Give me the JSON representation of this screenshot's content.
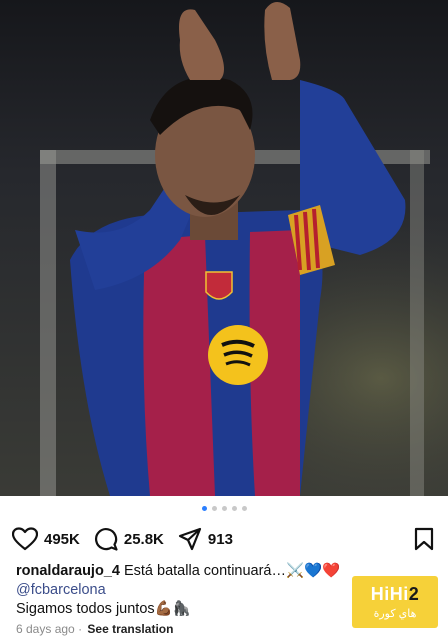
{
  "post": {
    "image_alt": "Player in blue and red striped jersey applauding with both hands raised",
    "carousel_count": 5,
    "carousel_active": 1
  },
  "actions": {
    "likes": "495K",
    "comments": "25.8K",
    "shares": "913"
  },
  "caption": {
    "username": "ronaldaraujo_4",
    "text": "Está batalla continuará…",
    "emojis": "⚔️💙❤️",
    "mention": "@fcbarcelona",
    "line3": "Sigamos todos juntos",
    "line3_emojis": "💪🏾🦍"
  },
  "meta": {
    "time": "6 days ago",
    "separator": "·",
    "translate": "See translation"
  },
  "watermark": {
    "brand_main": "HiHi",
    "brand_num": "2",
    "brand_sub": "هاي كورة"
  },
  "colors": {
    "accent_blue": "#2b7fff",
    "jersey_blue": "#1f3a8f",
    "jersey_red": "#a5204a",
    "watermark": "#f5cd28"
  }
}
